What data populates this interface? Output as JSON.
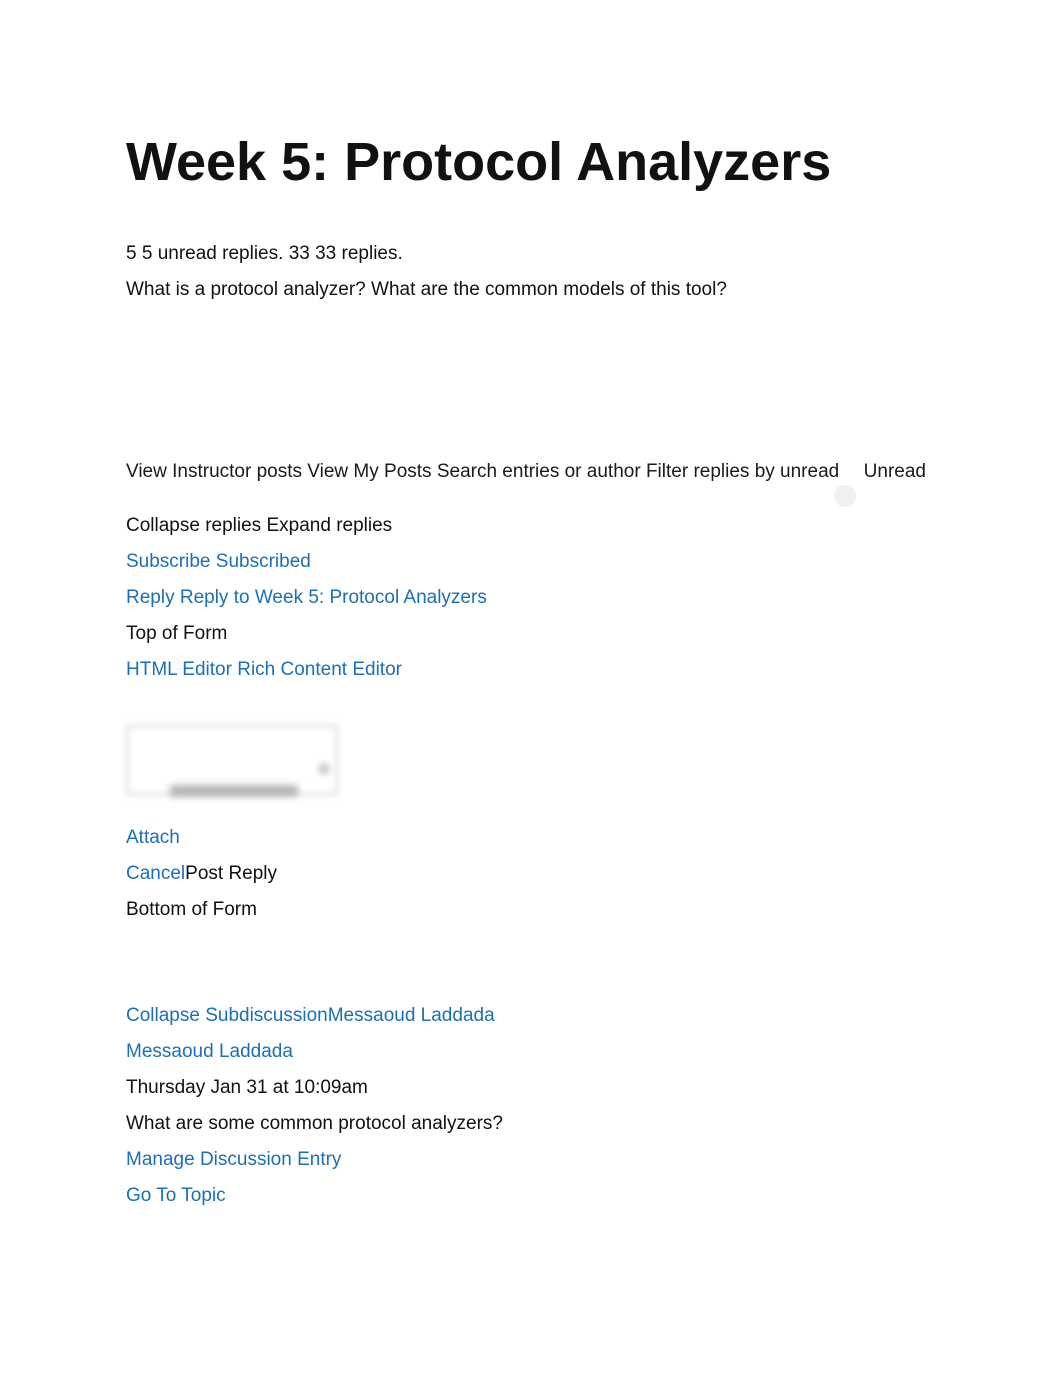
{
  "title": "Week 5: Protocol Analyzers",
  "meta": {
    "unread_num": "5",
    "unread_text": "5 unread replies.",
    "total_num": "33",
    "total_text": "33 replies."
  },
  "prompt": "What is a protocol analyzer? What are the common models of this tool?",
  "filters": {
    "view_instructor": "View Instructor posts",
    "view_my_posts": "View My Posts",
    "search": "Search entries or author",
    "filter_unread": "Filter replies by unread",
    "unread_label": "Unread",
    "collapse": "Collapse replies",
    "expand": "Expand replies"
  },
  "links": {
    "subscribe": "Subscribe",
    "subscribed": "Subscribed",
    "reply": "Reply",
    "reply_full": "Reply to Week 5: Protocol Analyzers",
    "html_editor": "HTML Editor",
    "rich_editor": "Rich Content Editor",
    "attach": "Attach",
    "cancel": "Cancel",
    "post_reply": "Post Reply",
    "collapse_sub": "Collapse Subdiscussion",
    "author": "Messaoud Laddada",
    "author2": "Messaoud Laddada",
    "manage": "Manage Discussion Entry",
    "goto": "Go To Topic"
  },
  "form": {
    "top": "Top of Form",
    "bottom": "Bottom of Form"
  },
  "post": {
    "timestamp": "Thursday Jan 31 at 10:09am",
    "body": "What are some common protocol analyzers?"
  }
}
